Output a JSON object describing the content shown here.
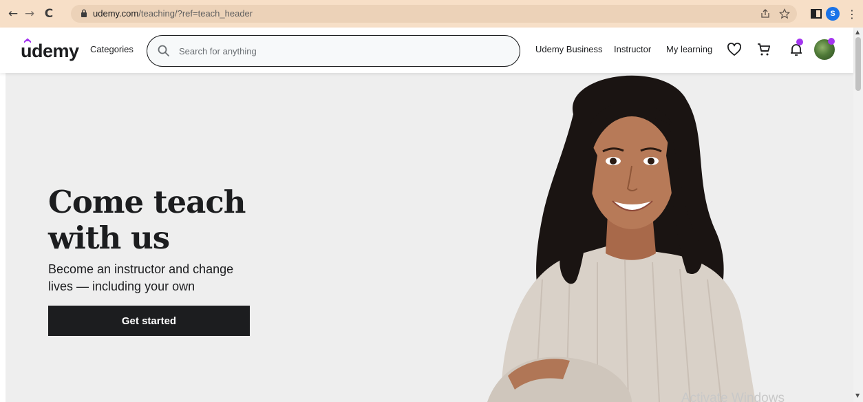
{
  "browser": {
    "back_icon": "back-arrow-icon",
    "forward_icon": "forward-arrow-icon",
    "reload_icon": "reload-icon",
    "url_host": "udemy.com",
    "url_path": "/teaching/?ref=teach_header",
    "profile_initial": "S",
    "chrome_color": "#f7dfc7"
  },
  "header": {
    "logo_text": "ûdemy",
    "categories_label": "Categories",
    "search_placeholder": "Search for anything",
    "links": {
      "business": "Udemy Business",
      "instructor": "Instructor",
      "my_learning": "My learning"
    },
    "icons": [
      "heart-icon",
      "cart-icon",
      "bell-icon"
    ],
    "accent_color": "#a435f0"
  },
  "hero": {
    "title": "Come teach with us",
    "subtitle": "Become an instructor and change lives — including your own",
    "cta_label": "Get started",
    "background": "#eeeeee"
  },
  "overlay": {
    "watermark": "Activate Windows"
  }
}
